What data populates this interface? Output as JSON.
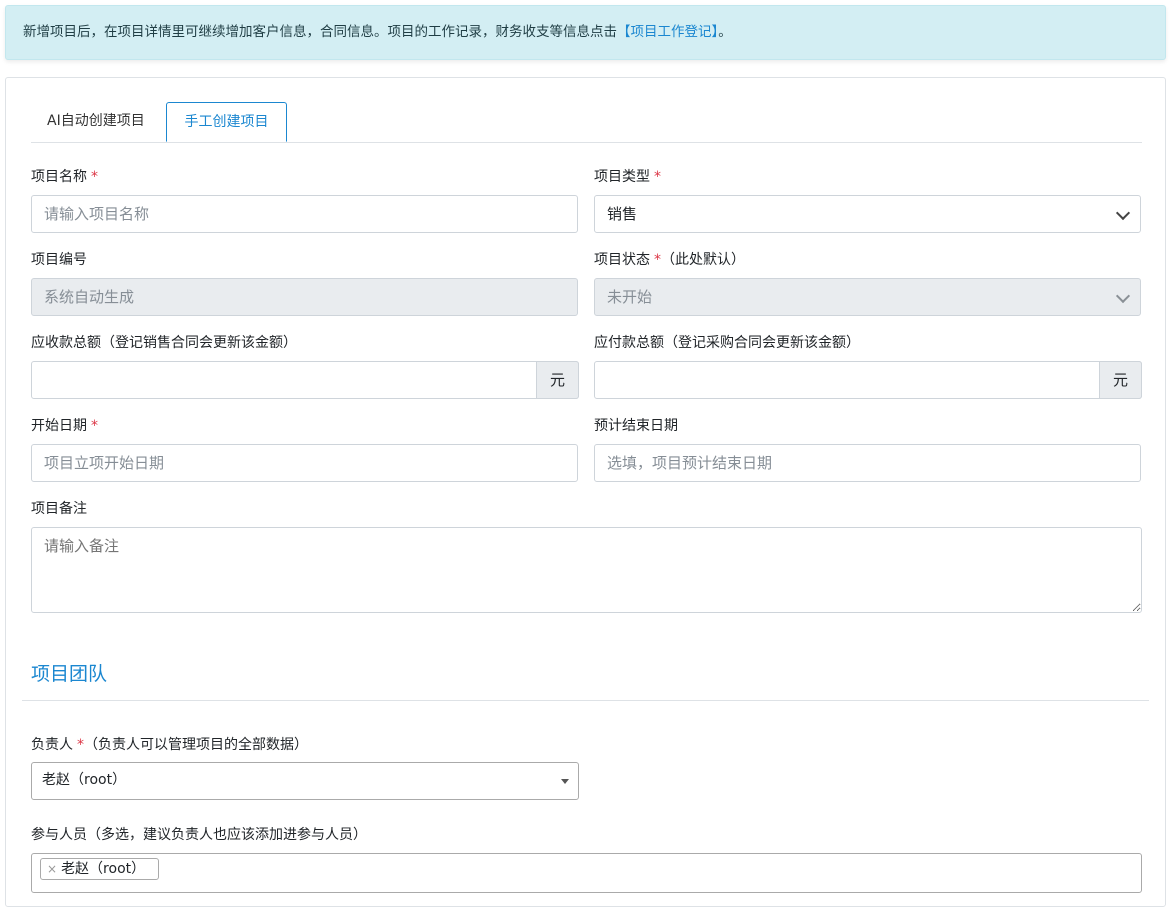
{
  "notice": {
    "text": "新增项目后，在项目详情里可继续增加客户信息，合同信息。项目的工作记录，财务收支等信息点击",
    "link": "【项目工作登记】",
    "suffix": "。"
  },
  "tabs": [
    {
      "label": "AI自动创建项目",
      "active": false
    },
    {
      "label": "手工创建项目",
      "active": true
    }
  ],
  "form": {
    "name": {
      "label": "项目名称",
      "required": "*",
      "placeholder": "请输入项目名称"
    },
    "type": {
      "label": "项目类型",
      "required": "*",
      "value": "销售"
    },
    "code": {
      "label": "项目编号",
      "placeholder": "系统自动生成"
    },
    "status": {
      "label": "项目状态",
      "required": "*",
      "hint": "（此处默认）",
      "value": "未开始"
    },
    "receivable": {
      "label": "应收款总额（登记销售合同会更新该金额）",
      "unit": "元",
      "value": ""
    },
    "payable": {
      "label": "应付款总额（登记采购合同会更新该金额）",
      "unit": "元",
      "value": ""
    },
    "start_date": {
      "label": "开始日期",
      "required": "*",
      "placeholder": "项目立项开始日期"
    },
    "end_date": {
      "label": "预计结束日期",
      "placeholder": "选填，项目预计结束日期"
    },
    "remark": {
      "label": "项目备注",
      "placeholder": "请输入备注"
    }
  },
  "team": {
    "title": "项目团队",
    "owner": {
      "label": "负责人",
      "required": "*",
      "hint": "（负责人可以管理项目的全部数据）",
      "value": "老赵（root）"
    },
    "members": {
      "label": "参与人员（多选，建议负责人也应该添加进参与人员）",
      "selected": [
        "老赵（root）"
      ],
      "remove_symbol": "×"
    }
  },
  "colors": {
    "accent": "#1b87d0",
    "required": "#dc3545",
    "notice_bg": "#d3eef3"
  }
}
